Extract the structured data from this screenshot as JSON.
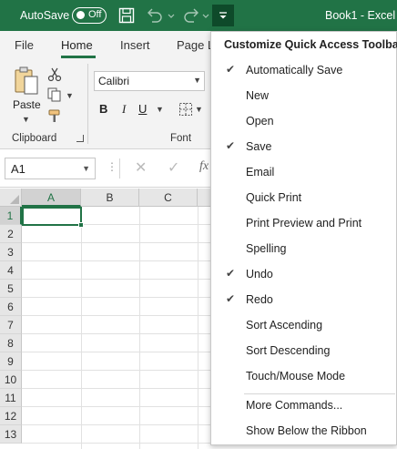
{
  "titlebar": {
    "autosave_label": "AutoSave",
    "autosave_state": "Off",
    "doc_title": "Book1  -  Excel",
    "accent_color": "#217346",
    "icons": [
      "save-icon",
      "undo-icon",
      "redo-icon",
      "customize-qat-icon"
    ]
  },
  "tabs": [
    "File",
    "Home",
    "Insert",
    "Page L"
  ],
  "ribbon": {
    "paste_label": "Paste",
    "clipboard_label": "Clipboard",
    "font_label": "Font",
    "font_name": "Calibri",
    "bold": "B",
    "italic": "I",
    "underline": "U"
  },
  "formula_bar": {
    "name_box": "A1",
    "fx": "fx"
  },
  "grid": {
    "columns": [
      "A",
      "B",
      "C"
    ],
    "rows": [
      "1",
      "2",
      "3",
      "4",
      "5",
      "6",
      "7",
      "8",
      "9",
      "10",
      "11",
      "12",
      "13"
    ],
    "active_cell": "A1"
  },
  "menu": {
    "title": "Customize Quick Access Toolbar",
    "items": [
      {
        "label": "Automatically Save",
        "checked": true
      },
      {
        "label": "New",
        "checked": false
      },
      {
        "label": "Open",
        "checked": false
      },
      {
        "label": "Save",
        "checked": true
      },
      {
        "label": "Email",
        "checked": false
      },
      {
        "label": "Quick Print",
        "checked": false
      },
      {
        "label": "Print Preview and Print",
        "checked": false
      },
      {
        "label": "Spelling",
        "checked": false
      },
      {
        "label": "Undo",
        "checked": true
      },
      {
        "label": "Redo",
        "checked": true
      },
      {
        "label": "Sort Ascending",
        "checked": false
      },
      {
        "label": "Sort Descending",
        "checked": false
      },
      {
        "label": "Touch/Mouse Mode",
        "checked": false
      },
      {
        "label": "More Commands...",
        "checked": false
      },
      {
        "label": "Show Below the Ribbon",
        "checked": false
      }
    ]
  }
}
